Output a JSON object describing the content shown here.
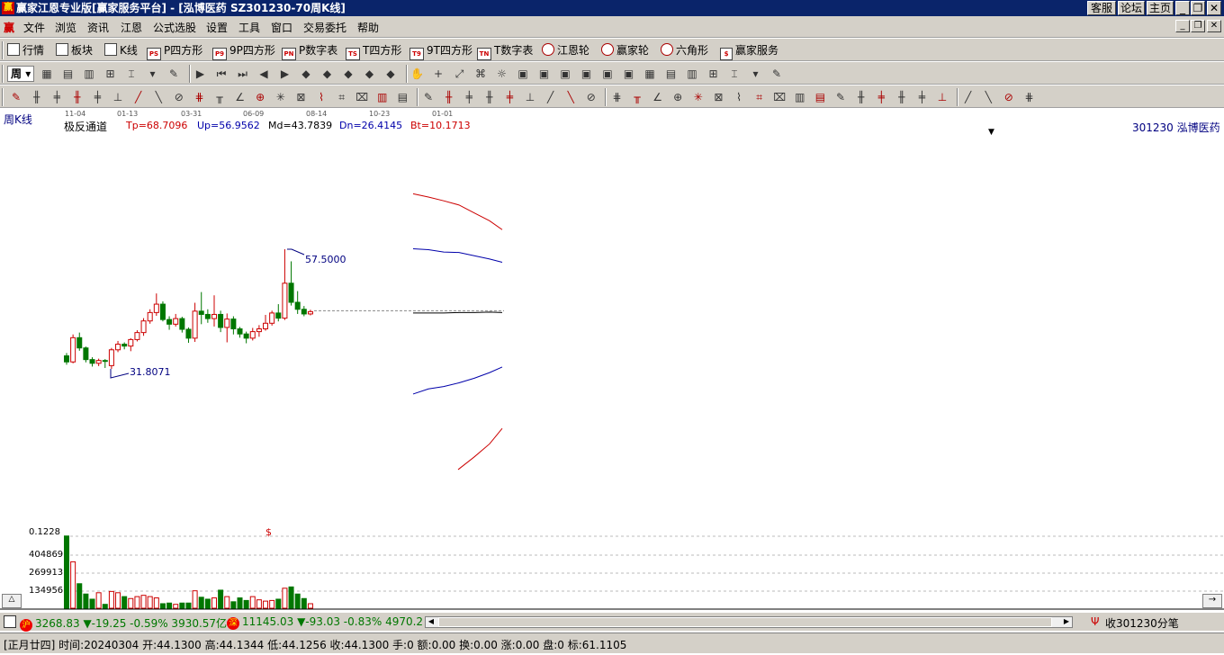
{
  "window": {
    "title": "赢家江恩专业版[赢家服务平台] - [泓博医药  SZ301230-70周K线]",
    "logo": "赢",
    "buttons": [
      "客服",
      "论坛",
      "主页"
    ]
  },
  "menu": {
    "logo": "赢",
    "items": [
      "文件",
      "浏览",
      "资讯",
      "江恩",
      "公式选股",
      "设置",
      "工具",
      "窗口",
      "交易委托",
      "帮助"
    ]
  },
  "toolbar1": {
    "items": [
      "行情",
      "板块",
      "K线",
      "P四方形",
      "9P四方形",
      "P数字表",
      "T四方形",
      "9T四方形",
      "T数字表",
      "江恩轮",
      "赢家轮",
      "六角形",
      "赢家服务"
    ],
    "icon_labels": [
      "",
      "",
      "",
      "PS",
      "P9",
      "PN",
      "TS",
      "T9",
      "TN",
      "",
      "",
      "",
      "$"
    ]
  },
  "toolbar2": {
    "period": "周",
    "icon_count": 35
  },
  "toolbar3": {
    "icon_count": 50
  },
  "chart": {
    "period_label": "周K线",
    "date_ticks": [
      "11-04",
      "01-13",
      "03-31",
      "06-09",
      "08-14",
      "10-23",
      "01-01"
    ],
    "indicator_name": "极反通道",
    "indicator_values": [
      "Tp=68.7096",
      "Up=56.9562",
      "Md=43.7839",
      "Dn=26.4145",
      "Bt=10.1713"
    ],
    "stock": "301230  泓博医药",
    "high_label": "57.5000",
    "low_label": "31.8071",
    "volume_axis": [
      "0.1228",
      "404869",
      "269913",
      "134956"
    ],
    "volume_marker": "$",
    "colors": {
      "up": "#cc0000",
      "down": "#007700",
      "tp": "#cc0000",
      "up_line": "#0000aa",
      "md": "#000000",
      "dn": "#0000aa",
      "bt": "#cc0000"
    }
  },
  "chart_data": {
    "type": "candlestick",
    "series": [
      {
        "o": 34.6,
        "c": 33.3,
        "h": 35.2,
        "l": 32.7
      },
      {
        "o": 33.3,
        "c": 38.5,
        "h": 39.2,
        "l": 33.0
      },
      {
        "o": 38.5,
        "c": 36.3,
        "h": 39.6,
        "l": 35.7
      },
      {
        "o": 36.3,
        "c": 33.8,
        "h": 36.6,
        "l": 33.2
      },
      {
        "o": 33.8,
        "c": 33.0,
        "h": 34.3,
        "l": 32.3
      },
      {
        "o": 33.0,
        "c": 33.6,
        "h": 34.0,
        "l": 32.4
      },
      {
        "o": 33.6,
        "c": 33.5,
        "h": 33.9,
        "l": 32.0
      },
      {
        "o": 32.5,
        "c": 35.9,
        "h": 36.3,
        "l": 31.8
      },
      {
        "o": 35.9,
        "c": 37.1,
        "h": 37.8,
        "l": 35.4
      },
      {
        "o": 37.1,
        "c": 36.7,
        "h": 37.5,
        "l": 36.0
      },
      {
        "o": 36.7,
        "c": 38.1,
        "h": 38.4,
        "l": 35.6
      },
      {
        "o": 38.1,
        "c": 39.6,
        "h": 40.1,
        "l": 37.7
      },
      {
        "o": 39.6,
        "c": 42.1,
        "h": 42.7,
        "l": 38.9
      },
      {
        "o": 42.1,
        "c": 43.9,
        "h": 44.6,
        "l": 41.5
      },
      {
        "o": 43.9,
        "c": 45.7,
        "h": 48.0,
        "l": 43.2
      },
      {
        "o": 45.7,
        "c": 42.4,
        "h": 46.3,
        "l": 42.0
      },
      {
        "o": 42.4,
        "c": 41.4,
        "h": 43.1,
        "l": 40.2
      },
      {
        "o": 41.4,
        "c": 42.6,
        "h": 43.6,
        "l": 40.9
      },
      {
        "o": 42.6,
        "c": 40.3,
        "h": 43.0,
        "l": 39.6
      },
      {
        "o": 40.3,
        "c": 38.4,
        "h": 40.7,
        "l": 37.4
      },
      {
        "o": 38.4,
        "c": 44.2,
        "h": 46.0,
        "l": 37.6
      },
      {
        "o": 44.2,
        "c": 43.5,
        "h": 48.3,
        "l": 41.4
      },
      {
        "o": 43.5,
        "c": 42.6,
        "h": 44.6,
        "l": 41.7
      },
      {
        "o": 42.6,
        "c": 43.5,
        "h": 47.6,
        "l": 40.9
      },
      {
        "o": 43.5,
        "c": 40.7,
        "h": 44.3,
        "l": 39.7
      },
      {
        "o": 40.7,
        "c": 42.5,
        "h": 43.7,
        "l": 37.5
      },
      {
        "o": 42.5,
        "c": 40.4,
        "h": 43.1,
        "l": 39.2
      },
      {
        "o": 40.4,
        "c": 39.3,
        "h": 40.8,
        "l": 38.5
      },
      {
        "o": 39.3,
        "c": 38.4,
        "h": 39.8,
        "l": 37.3
      },
      {
        "o": 38.4,
        "c": 39.8,
        "h": 40.6,
        "l": 37.9
      },
      {
        "o": 39.8,
        "c": 40.4,
        "h": 41.2,
        "l": 38.7
      },
      {
        "o": 40.4,
        "c": 41.6,
        "h": 43.4,
        "l": 40.0
      },
      {
        "o": 41.6,
        "c": 43.8,
        "h": 44.3,
        "l": 41.1
      },
      {
        "o": 43.8,
        "c": 42.7,
        "h": 45.7,
        "l": 42.0
      },
      {
        "o": 42.7,
        "c": 50.2,
        "h": 57.5,
        "l": 42.3
      },
      {
        "o": 50.2,
        "c": 46.1,
        "h": 54.9,
        "l": 45.4
      },
      {
        "o": 46.1,
        "c": 44.6,
        "h": 48.5,
        "l": 43.6
      },
      {
        "o": 44.6,
        "c": 43.6,
        "h": 45.3,
        "l": 43.1
      },
      {
        "o": 43.6,
        "c": 44.1,
        "h": 44.5,
        "l": 43.3
      }
    ],
    "volume": [
      560000,
      360000,
      190000,
      110000,
      70000,
      120000,
      30000,
      130000,
      120000,
      90000,
      75000,
      90000,
      100000,
      90000,
      80000,
      35000,
      40000,
      30000,
      40000,
      40000,
      135000,
      85000,
      70000,
      80000,
      140000,
      90000,
      50000,
      80000,
      60000,
      90000,
      65000,
      55000,
      60000,
      70000,
      155000,
      165000,
      110000,
      75000,
      35000
    ],
    "channel": {
      "tp": [
        69.4,
        68.7,
        67.9,
        67.0,
        65.3,
        63.6,
        61.7
      ],
      "up": [
        57.6,
        57.4,
        56.9,
        56.8,
        56.1,
        55.4,
        54.7
      ],
      "md": [
        43.8,
        43.8,
        43.8,
        43.9,
        43.9,
        44.0,
        43.9
      ],
      "dn": [
        26.4,
        27.5,
        28.0,
        28.8,
        29.8,
        31.0,
        32.2
      ],
      "bt": [
        10.17,
        12.9,
        15.7,
        19.0
      ]
    }
  },
  "statusbar": {
    "sh_badge": "沪",
    "sh_quote": "3268.83 ▼-19.25 -0.59% 3930.57亿",
    "sz_badge": "深",
    "sz_quote": "11145.03 ▼-93.03 -0.83% 4970.2",
    "tick_label": "收301230分笔",
    "info": "[正月廿四] 时间:20240304 开:44.1300 高:44.1344 低:44.1256 收:44.1300 手:0 额:0.00 换:0.00 涨:0.00 盘:0 标:61.1105"
  }
}
